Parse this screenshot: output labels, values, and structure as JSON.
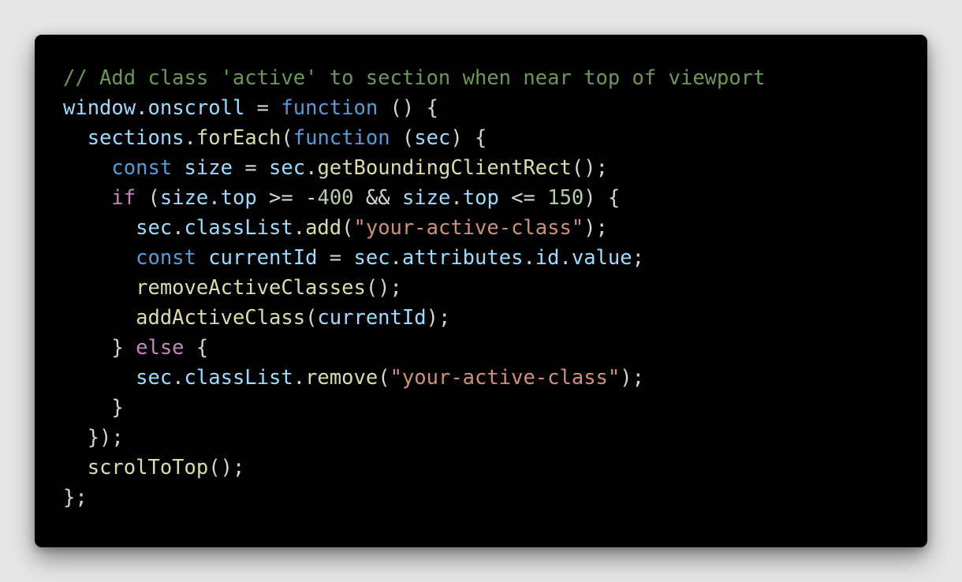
{
  "code": {
    "colors": {
      "background": "#000000",
      "page": "#e6e6e6",
      "comment": "#6a9955",
      "keyword": "#569cd6",
      "control": "#c586c0",
      "variable": "#9cdcfe",
      "function": "#dcdcaa",
      "string": "#ce9178",
      "number": "#b5cea8",
      "plain": "#d4d4d4"
    },
    "lines": [
      [
        [
          "comment",
          "// Add class 'active' to section when near top of viewport"
        ]
      ],
      [
        [
          "variable",
          "window"
        ],
        [
          "plain",
          "."
        ],
        [
          "variable",
          "onscroll"
        ],
        [
          "plain",
          " = "
        ],
        [
          "keyword",
          "function"
        ],
        [
          "plain",
          " () {"
        ]
      ],
      [
        [
          "plain",
          "  "
        ],
        [
          "variable",
          "sections"
        ],
        [
          "plain",
          "."
        ],
        [
          "function",
          "forEach"
        ],
        [
          "plain",
          "("
        ],
        [
          "keyword",
          "function"
        ],
        [
          "plain",
          " ("
        ],
        [
          "variable",
          "sec"
        ],
        [
          "plain",
          ") {"
        ]
      ],
      [
        [
          "plain",
          "    "
        ],
        [
          "keyword",
          "const"
        ],
        [
          "plain",
          " "
        ],
        [
          "variable",
          "size"
        ],
        [
          "plain",
          " = "
        ],
        [
          "variable",
          "sec"
        ],
        [
          "plain",
          "."
        ],
        [
          "function",
          "getBoundingClientRect"
        ],
        [
          "plain",
          "();"
        ]
      ],
      [
        [
          "plain",
          "    "
        ],
        [
          "control",
          "if"
        ],
        [
          "plain",
          " ("
        ],
        [
          "variable",
          "size"
        ],
        [
          "plain",
          "."
        ],
        [
          "variable",
          "top"
        ],
        [
          "plain",
          " >= -"
        ],
        [
          "number",
          "400"
        ],
        [
          "plain",
          " && "
        ],
        [
          "variable",
          "size"
        ],
        [
          "plain",
          "."
        ],
        [
          "variable",
          "top"
        ],
        [
          "plain",
          " <= "
        ],
        [
          "number",
          "150"
        ],
        [
          "plain",
          ") {"
        ]
      ],
      [
        [
          "plain",
          "      "
        ],
        [
          "variable",
          "sec"
        ],
        [
          "plain",
          "."
        ],
        [
          "variable",
          "classList"
        ],
        [
          "plain",
          "."
        ],
        [
          "function",
          "add"
        ],
        [
          "plain",
          "("
        ],
        [
          "string",
          "\"your-active-class\""
        ],
        [
          "plain",
          ");"
        ]
      ],
      [
        [
          "plain",
          "      "
        ],
        [
          "keyword",
          "const"
        ],
        [
          "plain",
          " "
        ],
        [
          "variable",
          "currentId"
        ],
        [
          "plain",
          " = "
        ],
        [
          "variable",
          "sec"
        ],
        [
          "plain",
          "."
        ],
        [
          "variable",
          "attributes"
        ],
        [
          "plain",
          "."
        ],
        [
          "variable",
          "id"
        ],
        [
          "plain",
          "."
        ],
        [
          "variable",
          "value"
        ],
        [
          "plain",
          ";"
        ]
      ],
      [
        [
          "plain",
          "      "
        ],
        [
          "function",
          "removeActiveClasses"
        ],
        [
          "plain",
          "();"
        ]
      ],
      [
        [
          "plain",
          "      "
        ],
        [
          "function",
          "addActiveClass"
        ],
        [
          "plain",
          "("
        ],
        [
          "variable",
          "currentId"
        ],
        [
          "plain",
          ");"
        ]
      ],
      [
        [
          "plain",
          "    } "
        ],
        [
          "control",
          "else"
        ],
        [
          "plain",
          " {"
        ]
      ],
      [
        [
          "plain",
          "      "
        ],
        [
          "variable",
          "sec"
        ],
        [
          "plain",
          "."
        ],
        [
          "variable",
          "classList"
        ],
        [
          "plain",
          "."
        ],
        [
          "function",
          "remove"
        ],
        [
          "plain",
          "("
        ],
        [
          "string",
          "\"your-active-class\""
        ],
        [
          "plain",
          ");"
        ]
      ],
      [
        [
          "plain",
          "    }"
        ]
      ],
      [
        [
          "plain",
          "  });"
        ]
      ],
      [
        [
          "plain",
          "  "
        ],
        [
          "function",
          "scrolToTop"
        ],
        [
          "plain",
          "();"
        ]
      ],
      [
        [
          "plain",
          "};"
        ]
      ]
    ]
  }
}
